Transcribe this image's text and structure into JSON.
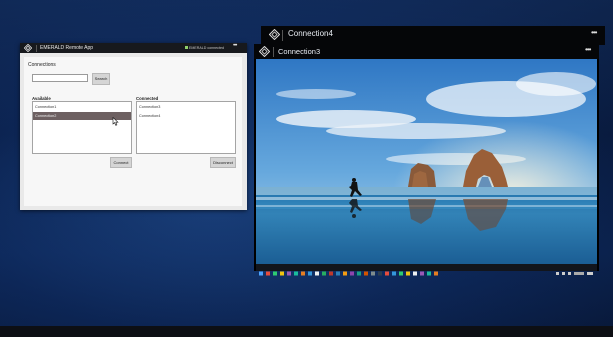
{
  "windows": {
    "connection4": {
      "title": "Connection4",
      "more": "•••"
    },
    "connection3": {
      "title": "Connection3",
      "more": "•••"
    }
  },
  "emerald_app": {
    "title": "EMERALD Remote App",
    "status": "EMERALD connected",
    "more": "•••",
    "section_title": "Connections",
    "search": {
      "value": "",
      "placeholder": "",
      "button": "Search"
    },
    "available": {
      "heading": "Available",
      "items": [
        "Connection1",
        "Connection2"
      ],
      "selected_index": 1,
      "button": "Connect"
    },
    "connected": {
      "heading": "Connected",
      "items": [
        "Connection3",
        "Connection4"
      ],
      "button": "Disconnect"
    }
  },
  "icons": {
    "logo": "emerald-logo-icon",
    "cursor": "mouse-pointer-icon"
  },
  "colors": {
    "titlebar": "#050608",
    "selection": "#6d6061",
    "panel": "#f7f7f7",
    "status_dot": "#8fd16a"
  }
}
